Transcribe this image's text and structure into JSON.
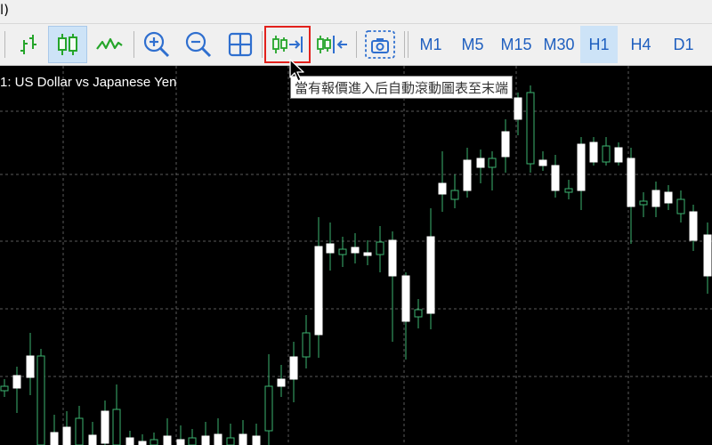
{
  "menubar": {
    "partial_text": "l)"
  },
  "toolbar": {
    "icons": [
      "bar-chart-icon",
      "candlestick-icon",
      "line-chart-icon",
      "zoom-in-icon",
      "zoom-out-icon",
      "tile-windows-icon",
      "auto-scroll-icon",
      "chart-shift-icon",
      "screenshot-icon"
    ],
    "timeframes": [
      "M1",
      "M5",
      "M15",
      "M30",
      "H1",
      "H4",
      "D1"
    ],
    "active_timeframe": "H1"
  },
  "chart": {
    "title": "1:  US Dollar vs Japanese Yen",
    "background": "#000000",
    "grid_color": "#5a5a5a",
    "bull_color": "#ffffff",
    "bear_color": "#ffffff",
    "wick_color": "#3cb371"
  },
  "tooltip": {
    "text": "當有報價進入后自動滾動圖表至末端"
  },
  "colors": {
    "accent": "#1f5fbf",
    "highlight_border": "#e2211c",
    "icon_green": "#25a52a",
    "icon_blue": "#2f6fcf"
  }
}
